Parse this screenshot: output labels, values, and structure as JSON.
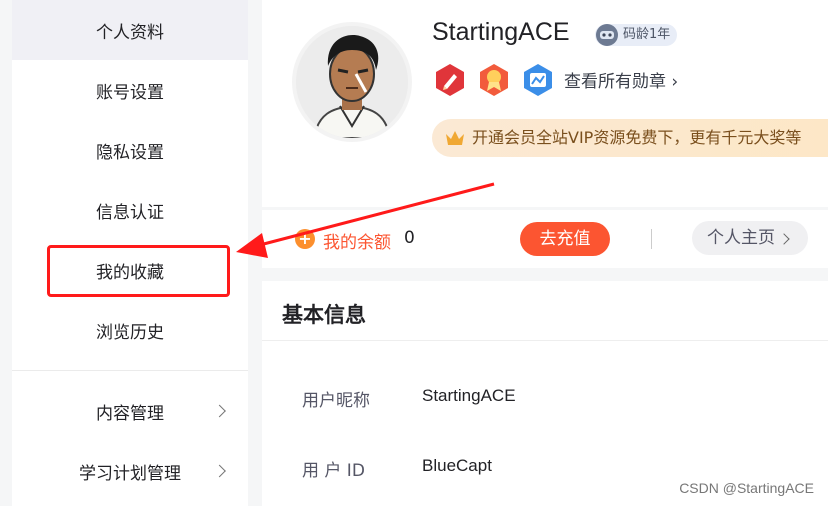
{
  "sidebar": {
    "items": [
      {
        "label": "个人资料",
        "active": true
      },
      {
        "label": "账号设置"
      },
      {
        "label": "隐私设置"
      },
      {
        "label": "信息认证"
      },
      {
        "label": "我的收藏"
      },
      {
        "label": "浏览历史"
      }
    ],
    "groups": [
      {
        "label": "内容管理"
      },
      {
        "label": "学习计划管理"
      }
    ]
  },
  "profile": {
    "username": "StartingACE",
    "code_age": "码龄1年",
    "medals_link": "查看所有勋章",
    "vip_text": "开通会员全站VIP资源免费下，更有千元大奖等"
  },
  "balance": {
    "label": "我的余额",
    "value": "0",
    "recharge": "去充值",
    "homepage": "个人主页"
  },
  "basic_info": {
    "title": "基本信息",
    "fields": [
      {
        "label": "用户昵称",
        "value": "StartingACE"
      },
      {
        "label": "用 户 ID",
        "value": "BlueCapt"
      }
    ]
  },
  "watermark": "CSDN @StartingACE",
  "colors": {
    "accent": "#fc5531",
    "annotation": "#ff1a1a"
  }
}
